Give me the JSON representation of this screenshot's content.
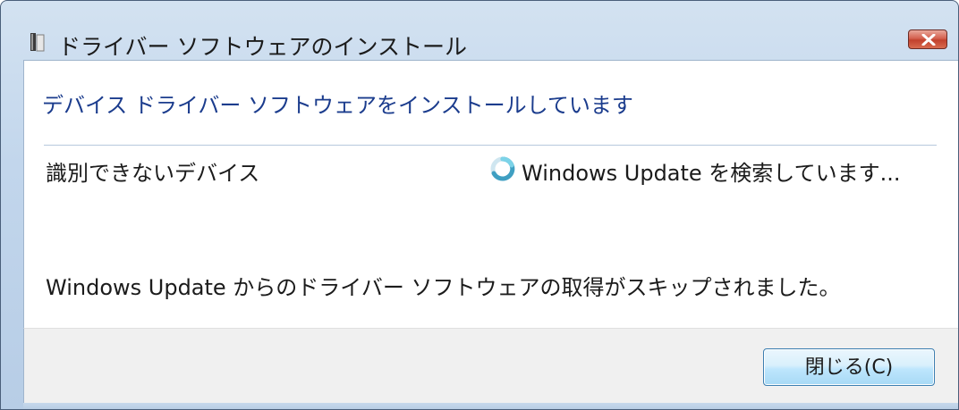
{
  "window": {
    "title": "ドライバー ソフトウェアのインストール",
    "title_icon": "driver-install-icon",
    "close_icon": "close-icon"
  },
  "content": {
    "heading": "デバイス ドライバー ソフトウェアをインストールしています",
    "device_name": "識別できないデバイス",
    "status_icon": "spinner-icon",
    "status_text": "Windows Update を検索しています...",
    "message": "Windows Update からのドライバー ソフトウェアの取得がスキップされました。"
  },
  "footer": {
    "close_button_label": "閉じる(C)"
  },
  "colors": {
    "heading": "#1b3c8d",
    "close_button_red": "#c2412d",
    "dialog_button_blue": "#bee6fd"
  }
}
